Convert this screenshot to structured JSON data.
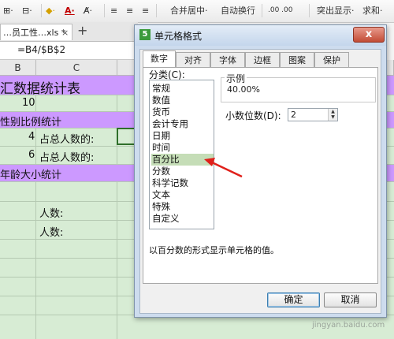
{
  "toolbar": {
    "merge_center": "合并居中·",
    "auto_wrap": "自动换行",
    "highlight": "突出显示·",
    "sum": "求和·",
    "decimal_buttons": ".00 .00"
  },
  "tabbar": {
    "doc_tab": "…员工性…xls *",
    "close": "×",
    "add": "+"
  },
  "formula_bar": {
    "value": "=B4/$B$2"
  },
  "sheet": {
    "columns": [
      "B",
      "C"
    ],
    "title": "汇数据统计表",
    "row_total_value": "10",
    "gender_section": "性别比例统计",
    "row_male_value": "4",
    "row_male_label": "占总人数的:",
    "row_female_value": "6",
    "row_female_label": "占总人数的:",
    "age_section": "年龄大小统计",
    "count_label_1": "人数:",
    "count_label_2": "人数:",
    "colors": {
      "purple_fill": "#cc99ff",
      "sheet_bg": "#d7ecd4"
    }
  },
  "dialog": {
    "title": "单元格格式",
    "close_label": "x",
    "tabs": [
      "数字",
      "对齐",
      "字体",
      "边框",
      "图案",
      "保护"
    ],
    "active_tab": "数字",
    "category_label": "分类(C):",
    "categories": [
      "常规",
      "数值",
      "货币",
      "会计专用",
      "日期",
      "时间",
      "百分比",
      "分数",
      "科学记数",
      "文本",
      "特殊",
      "自定义"
    ],
    "selected_category": "百分比",
    "sample_label": "示例",
    "sample_value": "40.00%",
    "decimal_label": "小数位数(D):",
    "decimal_value": "2",
    "description": "以百分数的形式显示单元格的值。",
    "ok_button": "确定",
    "cancel_button": "取消"
  },
  "watermark": "jingyan.baidu.com"
}
